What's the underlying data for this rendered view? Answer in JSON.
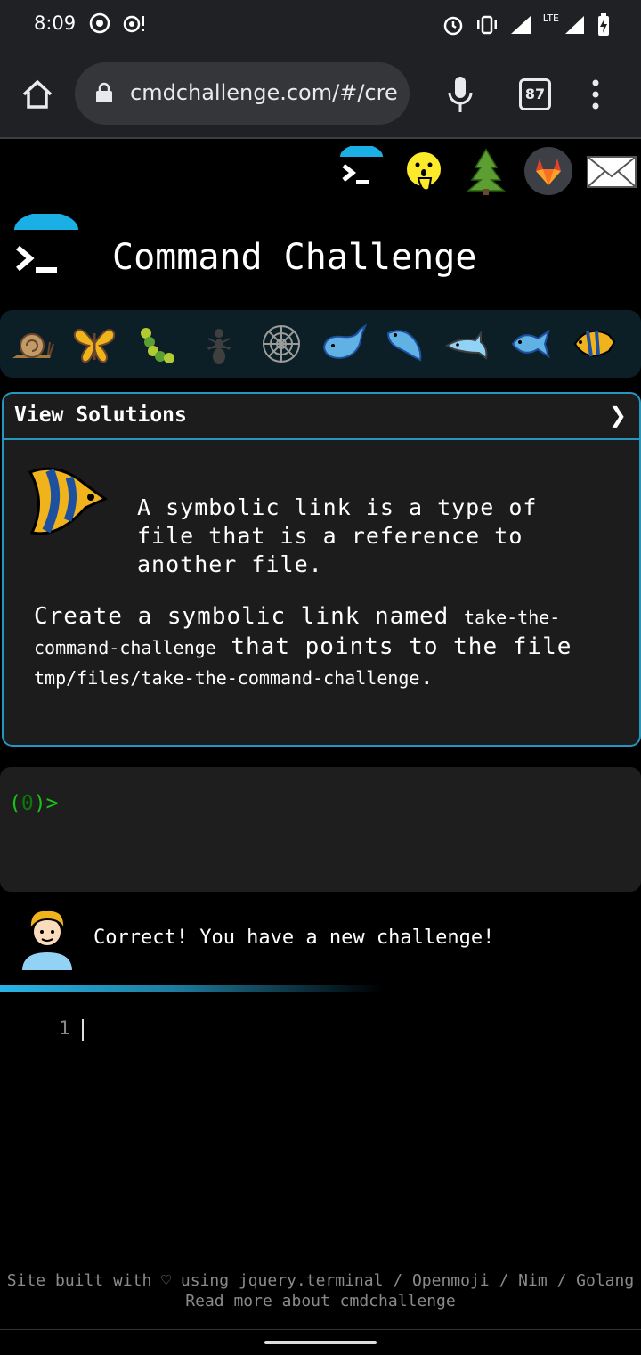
{
  "status_bar": {
    "time": "8:09",
    "network": "LTE",
    "left_icons": [
      "chrome-icon",
      "notification-icon"
    ],
    "right_icons": [
      "alarm-icon",
      "vibrate-icon",
      "signal-icon",
      "lte-signal-icon",
      "battery-charging-icon"
    ]
  },
  "browser": {
    "url": "cmdchallenge.com/#/create",
    "tab_count": "87",
    "icons": [
      "home-icon",
      "lock-icon",
      "mic-icon",
      "tabs-icon",
      "menu-icon"
    ]
  },
  "top_icons": [
    "terminal-logo-icon",
    "shushing-face-icon",
    "tree-icon",
    "gitlab-icon",
    "envelope-icon"
  ],
  "brand": {
    "title": "Command Challenge"
  },
  "levels": [
    "snail-icon",
    "butterfly-icon",
    "caterpillar-icon",
    "ant-icon",
    "spider-web-icon",
    "whale-icon",
    "manatee-icon",
    "dolphin-icon",
    "fish-icon",
    "tropical-fish-icon"
  ],
  "challenge": {
    "header": "View Solutions",
    "chevron": "❯",
    "intro": "A symbolic link is a type of file that is a reference to another file.",
    "task_prefix": "Create a symbolic link named ",
    "link_name": "take-the-command-challenge",
    "task_middle": " that points to the file ",
    "target_path": "tmp/files/take-the-command-challenge",
    "task_suffix": "."
  },
  "terminal": {
    "open": "(",
    "count": "0",
    "close": ")>"
  },
  "feedback": {
    "message": "Correct! You have a new challenge!"
  },
  "editor": {
    "line_number": "1"
  },
  "footer": {
    "line1": "Site built with ♡ using jquery.terminal / Openmoji / Nim / Golang",
    "line2": "Read more about cmdchallenge"
  },
  "colors": {
    "accent": "#2596be",
    "prompt_green": "#19c319",
    "background": "#000000"
  }
}
